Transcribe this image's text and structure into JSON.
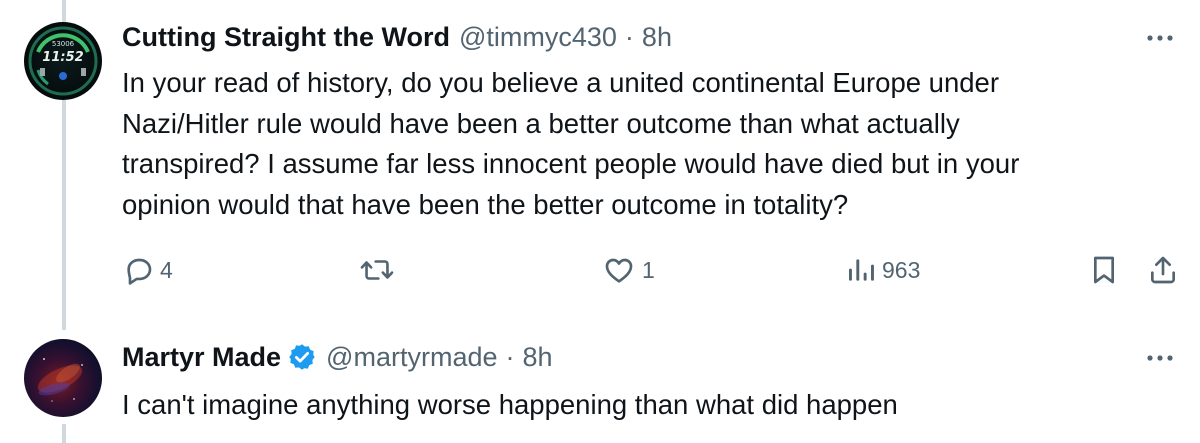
{
  "tweets": [
    {
      "display_name": "Cutting Straight the Word",
      "handle": "@timmyc430",
      "separator": "·",
      "time": "8h",
      "text": "In your read of history, do you believe a united continental Europe under\nNazi/Hitler rule would have been a better outcome than what actually\ntranspired? I assume far less innocent people would have died but in your\nopinion would that have been the better outcome in totality?",
      "avatar_text": {
        "top": "53006",
        "time": "11:52"
      },
      "stats": {
        "replies": "4",
        "likes": "1",
        "views": "963"
      }
    },
    {
      "display_name": "Martyr Made",
      "handle": "@martyrmade",
      "separator": "·",
      "time": "8h",
      "text": "I can't imagine anything worse happening than what did happen",
      "verified": true
    }
  ],
  "icons": {
    "reply": "reply-icon",
    "retweet": "retweet-icon",
    "like": "like-icon",
    "views": "views-icon",
    "bookmark": "bookmark-icon",
    "share": "share-icon",
    "more": "more-icon",
    "verified": "verified-badge-icon"
  },
  "colors": {
    "text": "#0f1419",
    "secondary": "#536471",
    "thread_line": "#cfd9de",
    "verified": "#1d9bf0"
  }
}
